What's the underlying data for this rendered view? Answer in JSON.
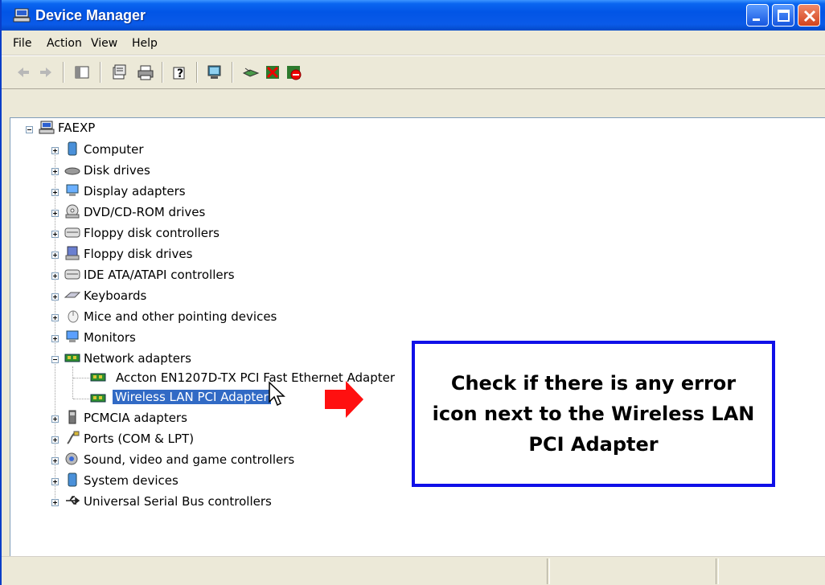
{
  "window": {
    "title": "Device Manager",
    "title_color": "#0255e6",
    "controls": [
      "minimize-icon",
      "maximize-icon",
      "close-icon"
    ]
  },
  "menu": [
    "File",
    "Action",
    "View",
    "Help"
  ],
  "toolbar_icons": [
    "back-arrow-icon",
    "forward-arrow-icon",
    "show-hide-console-tree-icon",
    "properties-icon",
    "print-icon",
    "help-icon",
    "scan-hardware-icon",
    "update-driver-icon",
    "uninstall-icon",
    "disable-icon"
  ],
  "tree": {
    "root": "FAEXP",
    "nodes": [
      {
        "label": "Computer",
        "icon": "computer-icon"
      },
      {
        "label": "Disk drives",
        "icon": "disk-drive-icon"
      },
      {
        "label": "Display adapters",
        "icon": "display-adapter-icon"
      },
      {
        "label": "DVD/CD-ROM drives",
        "icon": "dvd-drive-icon"
      },
      {
        "label": "Floppy disk controllers",
        "icon": "controller-icon"
      },
      {
        "label": "Floppy disk drives",
        "icon": "floppy-drive-icon"
      },
      {
        "label": "IDE ATA/ATAPI controllers",
        "icon": "controller-icon"
      },
      {
        "label": "Keyboards",
        "icon": "keyboard-icon"
      },
      {
        "label": "Mice and other pointing devices",
        "icon": "mouse-icon"
      },
      {
        "label": "Monitors",
        "icon": "monitor-icon"
      },
      {
        "label": "Network adapters",
        "icon": "network-card-icon",
        "expanded": true
      },
      {
        "label": "PCMCIA adapters",
        "icon": "pcmcia-icon"
      },
      {
        "label": "Ports (COM & LPT)",
        "icon": "port-icon"
      },
      {
        "label": "Sound, video and game controllers",
        "icon": "sound-icon"
      },
      {
        "label": "System devices",
        "icon": "system-device-icon"
      },
      {
        "label": "Universal Serial Bus controllers",
        "icon": "usb-icon"
      }
    ],
    "network_children": [
      {
        "label": "Accton EN1207D-TX PCI Fast Ethernet Adapter"
      },
      {
        "label": "Wireless LAN PCI Adapter",
        "selected": true
      }
    ]
  },
  "callout": {
    "text": "Check if there is any error icon next to the Wireless LAN PCI Adapter",
    "border_color": "#1010e8",
    "arrow_color": "#ff0000"
  }
}
